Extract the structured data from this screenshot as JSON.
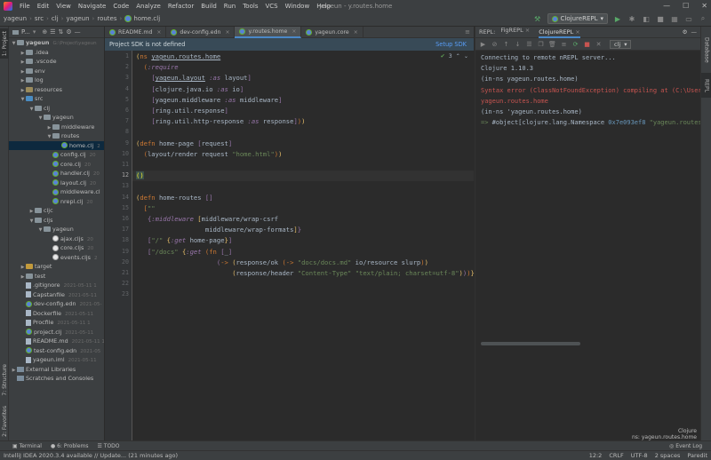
{
  "window": {
    "title": "yageun - y.routes.home"
  },
  "menu": [
    "File",
    "Edit",
    "View",
    "Navigate",
    "Code",
    "Analyze",
    "Refactor",
    "Build",
    "Run",
    "Tools",
    "VCS",
    "Window",
    "Help"
  ],
  "breadcrumbs": [
    "yageun",
    "src",
    "clj",
    "yageun",
    "routes",
    "home.clj"
  ],
  "run_config": {
    "label": "ClojureREPL"
  },
  "left_strip": {
    "project": "1: Project",
    "structure": "7: Structure",
    "favorites": "2: Favorites"
  },
  "project": {
    "header": "P...",
    "tree": [
      {
        "label": "yageun",
        "meta": "G:\\Project\\yageun",
        "depth": 0,
        "arrow": "down",
        "icon": "folder"
      },
      {
        "label": ".idea",
        "depth": 1,
        "arrow": "right",
        "icon": "folder"
      },
      {
        "label": ".vscode",
        "depth": 1,
        "arrow": "right",
        "icon": "folder"
      },
      {
        "label": "env",
        "depth": 1,
        "arrow": "right",
        "icon": "folder"
      },
      {
        "label": "log",
        "depth": 1,
        "arrow": "right",
        "icon": "folder"
      },
      {
        "label": "resources",
        "depth": 1,
        "arrow": "right",
        "icon": "res"
      },
      {
        "label": "src",
        "depth": 1,
        "arrow": "down",
        "icon": "src"
      },
      {
        "label": "clj",
        "depth": 2,
        "arrow": "down",
        "icon": "folder"
      },
      {
        "label": "yageun",
        "depth": 3,
        "arrow": "down",
        "icon": "folder"
      },
      {
        "label": "middleware",
        "depth": 4,
        "arrow": "right",
        "icon": "folder"
      },
      {
        "label": "routes",
        "depth": 4,
        "arrow": "down",
        "icon": "folder"
      },
      {
        "label": "home.clj",
        "depth": 5,
        "arrow": "",
        "icon": "clj",
        "meta": "2",
        "selected": true
      },
      {
        "label": "config.clj",
        "depth": 4,
        "arrow": "",
        "icon": "clj",
        "meta": "20"
      },
      {
        "label": "core.clj",
        "depth": 4,
        "arrow": "",
        "icon": "clj",
        "meta": "20"
      },
      {
        "label": "handler.clj",
        "depth": 4,
        "arrow": "",
        "icon": "clj",
        "meta": "20"
      },
      {
        "label": "layout.clj",
        "depth": 4,
        "arrow": "",
        "icon": "clj",
        "meta": "20"
      },
      {
        "label": "middleware.cl",
        "depth": 4,
        "arrow": "",
        "icon": "clj",
        "meta": ""
      },
      {
        "label": "nrepl.clj",
        "depth": 4,
        "arrow": "",
        "icon": "clj",
        "meta": "20"
      },
      {
        "label": "cljc",
        "depth": 2,
        "arrow": "right",
        "icon": "folder"
      },
      {
        "label": "cljs",
        "depth": 2,
        "arrow": "down",
        "icon": "folder"
      },
      {
        "label": "yageun",
        "depth": 3,
        "arrow": "down",
        "icon": "folder"
      },
      {
        "label": "ajax.cljs",
        "depth": 4,
        "arrow": "",
        "icon": "cljs",
        "meta": "20"
      },
      {
        "label": "core.cljs",
        "depth": 4,
        "arrow": "",
        "icon": "cljs",
        "meta": "20"
      },
      {
        "label": "events.cljs",
        "depth": 4,
        "arrow": "",
        "icon": "cljs",
        "meta": "2"
      },
      {
        "label": "target",
        "depth": 1,
        "arrow": "right",
        "icon": "excl"
      },
      {
        "label": "test",
        "depth": 1,
        "arrow": "right",
        "icon": "folder"
      },
      {
        "label": ".gitignore",
        "depth": 1,
        "arrow": "",
        "icon": "file",
        "meta": "2021-05-11 1"
      },
      {
        "label": "Capstanfile",
        "depth": 1,
        "arrow": "",
        "icon": "file",
        "meta": "2021-05-11"
      },
      {
        "label": "dev-config.edn",
        "depth": 1,
        "arrow": "",
        "icon": "clj",
        "meta": "2021-05-"
      },
      {
        "label": "Dockerfile",
        "depth": 1,
        "arrow": "",
        "icon": "file",
        "meta": "2021-05-11"
      },
      {
        "label": "Procfile",
        "depth": 1,
        "arrow": "",
        "icon": "file",
        "meta": "2021-05-11 1"
      },
      {
        "label": "project.clj",
        "depth": 1,
        "arrow": "",
        "icon": "clj",
        "meta": "2021-05-11"
      },
      {
        "label": "README.md",
        "depth": 1,
        "arrow": "",
        "icon": "file",
        "meta": "2021-05-11 1"
      },
      {
        "label": "test-config.edn",
        "depth": 1,
        "arrow": "",
        "icon": "clj",
        "meta": "2021-05"
      },
      {
        "label": "yageun.iml",
        "depth": 1,
        "arrow": "",
        "icon": "file",
        "meta": "2021-05-11"
      },
      {
        "label": "External Libraries",
        "depth": 0,
        "arrow": "right",
        "icon": "lib"
      },
      {
        "label": "Scratches and Consoles",
        "depth": 0,
        "arrow": "",
        "icon": "lib"
      }
    ]
  },
  "editor_tabs": [
    {
      "label": "README.md",
      "active": false
    },
    {
      "label": "dev-config.edn",
      "active": false
    },
    {
      "label": "y.routes.home",
      "active": true
    },
    {
      "label": "yageun.core",
      "active": false
    }
  ],
  "sdk_banner": {
    "message": "Project SDK is not defined",
    "action": "Setup SDK"
  },
  "inspection": {
    "count": "3"
  },
  "editor": {
    "current_line": 12,
    "lines": [
      {
        "n": 1,
        "html": "<span class='p1'>(</span><span class='kw'>ns</span> <span style='text-decoration:underline'>yageun.routes.home</span>"
      },
      {
        "n": 2,
        "html": "  <span class='p2'>(</span><span class='kwd'>:require</span>"
      },
      {
        "n": 3,
        "html": "    <span class='p3'>[</span><span style='text-decoration:underline'>yageun.layout</span> <span class='kwd'>:as</span> layout<span class='p3'>]</span>"
      },
      {
        "n": 4,
        "html": "    <span class='p3'>[</span>clojure.java.io <span class='kwd'>:as</span> io<span class='p3'>]</span>"
      },
      {
        "n": 5,
        "html": "    <span class='p3'>[</span>yageun.middleware <span class='kwd'>:as</span> middleware<span class='p3'>]</span>"
      },
      {
        "n": 6,
        "html": "    <span class='p3'>[</span>ring.util.response<span class='p3'>]</span>"
      },
      {
        "n": 7,
        "html": "    <span class='p3'>[</span>ring.util.http-response <span class='kwd'>:as</span> response<span class='p3'>]</span><span class='p2'>)</span><span class='p1'>)</span>"
      },
      {
        "n": 8,
        "html": ""
      },
      {
        "n": 9,
        "html": "<span class='p1'>(</span><span class='kw'>defn</span> home-page <span class='p3'>[</span>request<span class='p3'>]</span>"
      },
      {
        "n": 10,
        "html": "  <span class='p2'>(</span>layout/render request <span class='str'>\"home.html\"</span><span class='p2'>)</span><span class='p1'>)</span>"
      },
      {
        "n": 11,
        "html": ""
      },
      {
        "n": 12,
        "html": "<span style='color:#ffef28;background:#3b514d'>()</span>"
      },
      {
        "n": 13,
        "html": ""
      },
      {
        "n": 14,
        "html": "<span class='p1'>(</span><span class='kw'>defn</span> home-routes <span class='p3'>[</span><span class='p3'>]</span>"
      },
      {
        "n": 15,
        "html": "  <span class='p2'>[</span><span class='str'>\"\"</span>"
      },
      {
        "n": 16,
        "html": "   <span class='p3'>{</span><span class='kwd'>:middleware</span> <span class='p1'>[</span>middleware/wrap-csrf"
      },
      {
        "n": 17,
        "html": "                  middleware/wrap-formats<span class='p1'>]</span><span class='p3'>}</span>"
      },
      {
        "n": 18,
        "html": "   <span class='p3'>[</span><span class='str'>\"/\"</span> <span class='p1'>{</span><span class='kwd'>:get</span> home-page<span class='p1'>}</span><span class='p3'>]</span>"
      },
      {
        "n": 19,
        "html": "   <span class='p3'>[</span><span class='str'>\"/docs\"</span> <span class='p1'>{</span><span class='kwd'>:get</span> <span class='p2'>(</span><span class='kw'>fn</span> <span class='p3'>[</span>_<span class='p3'>]</span>"
      },
      {
        "n": 20,
        "html": "                     <span class='p3'>(</span><span class='kw'>-&gt;</span> <span class='p1'>(</span>response/ok <span class='p2'>(</span><span class='kw'>-&gt;</span> <span class='str'>\"docs/docs.md\"</span> io/resource slurp<span class='p2'>)</span><span class='p1'>)</span>"
      },
      {
        "n": 21,
        "html": "                         <span class='p1'>(</span>response/header <span class='str'>\"Content-Type\"</span> <span class='str'>\"text/plain; charset=utf-8\"</span><span class='p1'>)</span><span class='p3'>)</span><span class='p2'>)</span><span class='p1'>}</span><span class='p3'>]</span><span class='p2'>]</span><span class='p1'>)</span>"
      },
      {
        "n": 22,
        "html": ""
      },
      {
        "n": 23,
        "html": ""
      }
    ]
  },
  "repl": {
    "label": "REPL:",
    "tabs": [
      {
        "label": "FigREPL",
        "active": false
      },
      {
        "label": "ClojureREPL",
        "active": true
      }
    ],
    "ns_select": "clj",
    "lines": [
      {
        "text": "Connecting to remote nREPL server...",
        "kind": "normal"
      },
      {
        "text": "Clojure 1.10.3",
        "kind": "normal"
      },
      {
        "text": "(in-ns yageun.routes.home)",
        "kind": "normal"
      },
      {
        "text": "Syntax error (ClassNotFoundException) compiling at (C:\\Users\\",
        "kind": "err"
      },
      {
        "text": "yageun.routes.home",
        "kind": "err"
      },
      {
        "text": "(in-ns 'yageun.routes.home)",
        "kind": "normal"
      },
      {
        "text": "=> #object[clojure.lang.Namespace 0x7e093ef8 \"yageun.routes.ho",
        "kind": "result"
      }
    ],
    "footer_lang": "Clojure",
    "footer_ns": "ns: yageun.routes.home"
  },
  "right_strip": {
    "database": "Database",
    "repl": "REPL"
  },
  "bottom_tools": {
    "terminal": "Terminal",
    "problems": "6: Problems",
    "todo": "TODO",
    "event_log": "Event Log"
  },
  "status": {
    "message": "IntelliJ IDEA 2020.3.4 available // Update... (21 minutes ago)",
    "position": "12:2",
    "line_sep": "CRLF",
    "encoding": "UTF-8",
    "indent": "2 spaces",
    "mode": "Paredit"
  }
}
